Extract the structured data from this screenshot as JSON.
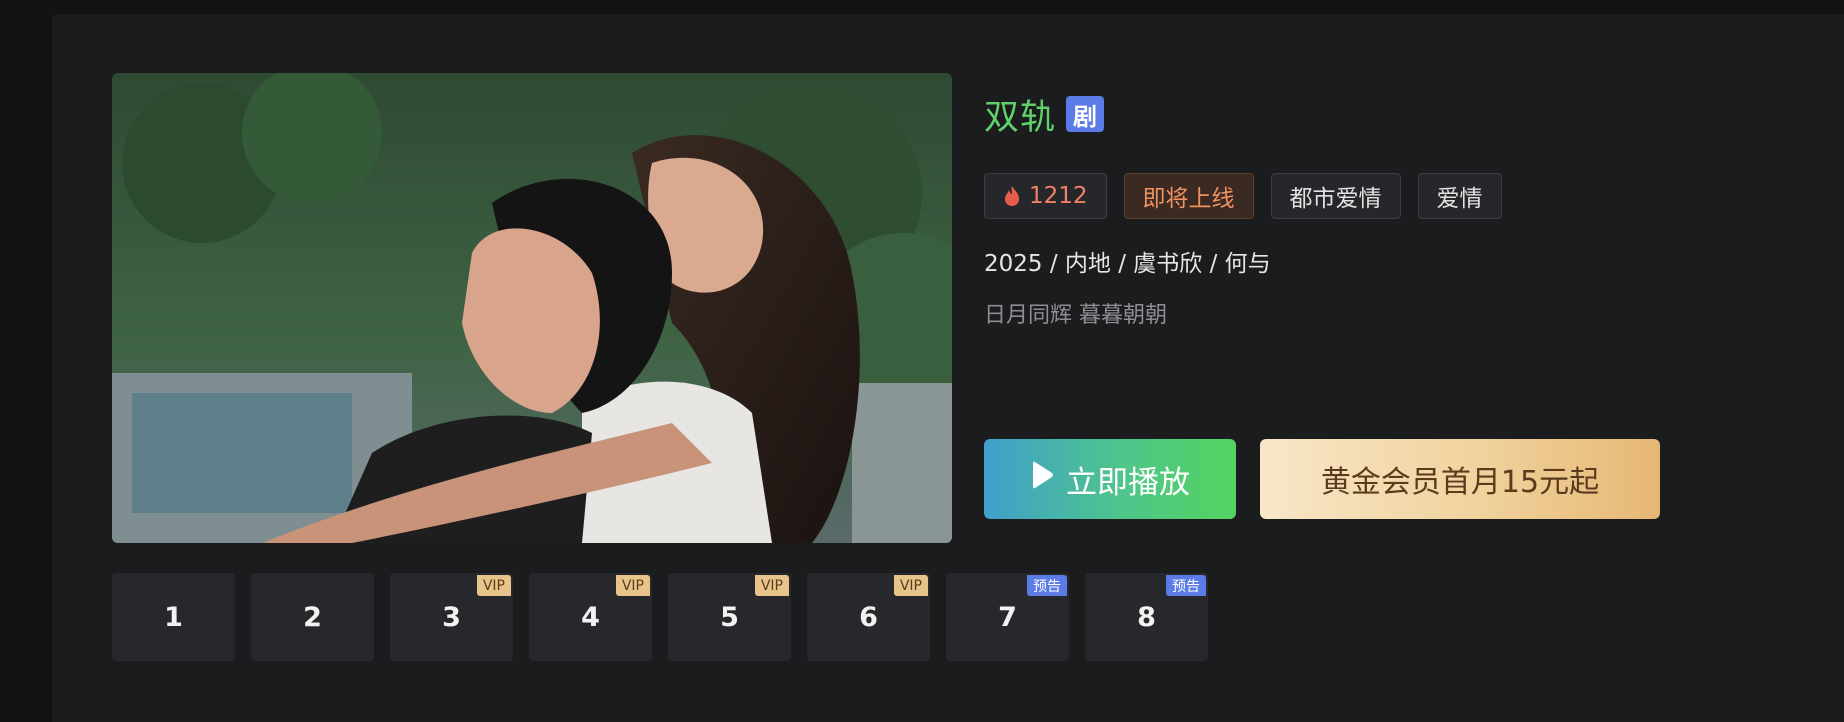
{
  "show": {
    "title": "双轨",
    "type_badge": "剧",
    "heat": "1212",
    "tags": [
      "即将上线",
      "都市爱情",
      "爱情"
    ],
    "meta": "2025 / 内地 / 虞书欣 / 何与",
    "subtitle": "日月同辉 暮暮朝朝"
  },
  "actions": {
    "play_label": "立即播放",
    "vip_label": "黄金会员首月15元起"
  },
  "episodes": [
    {
      "number": "1",
      "badge": ""
    },
    {
      "number": "2",
      "badge": ""
    },
    {
      "number": "3",
      "badge": "VIP"
    },
    {
      "number": "4",
      "badge": "VIP"
    },
    {
      "number": "5",
      "badge": "VIP"
    },
    {
      "number": "6",
      "badge": "VIP"
    },
    {
      "number": "7",
      "badge": "预告"
    },
    {
      "number": "8",
      "badge": "预告"
    }
  ],
  "colors": {
    "title": "#5fd06a",
    "type_badge": "#5b7be6",
    "vip_badge": "#e8c48a",
    "preview_badge": "#5b7be6"
  },
  "icons": {
    "heat": "fire-icon",
    "play": "play-icon"
  }
}
